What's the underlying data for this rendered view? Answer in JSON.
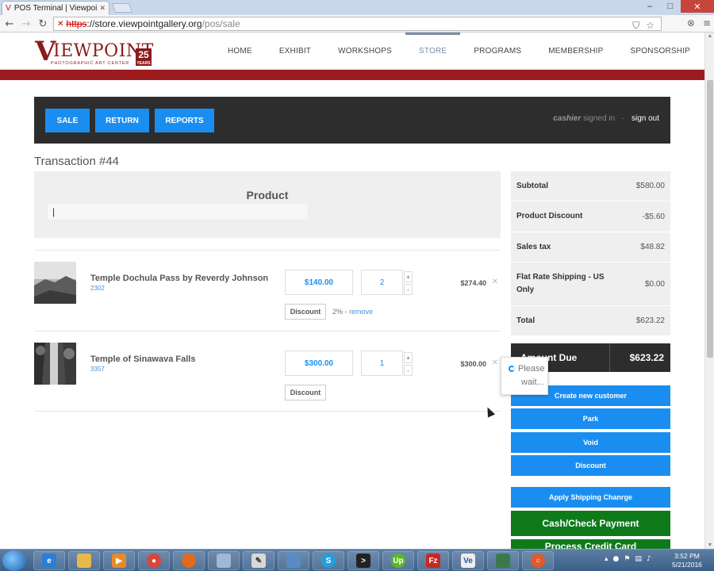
{
  "browser": {
    "tab_title": "POS Terminal | Viewpoint",
    "url_protocol": "https",
    "url_host": "://store.viewpointgallery.org",
    "url_path": "/pos/sale"
  },
  "site": {
    "logo_text": "VIEWPOINT",
    "logo_tagline": "PHOTOGRAPHIC ART CENTER",
    "logo_badge": "25",
    "logo_badge_sub": "YEARS",
    "nav": [
      "HOME",
      "EXHIBIT",
      "WORKSHOPS",
      "STORE",
      "PROGRAMS",
      "MEMBERSHIP",
      "SPONSORSHIP"
    ],
    "active_nav": "STORE",
    "brand_color": "#9b1b1f"
  },
  "pos": {
    "buttons": {
      "sale": "SALE",
      "return": "RETURN",
      "reports": "REPORTS"
    },
    "cashier": "cashier",
    "signed_in": "signed in",
    "sign_out": "sign out",
    "transaction_title": "Transaction #44",
    "product_label": "Product",
    "product_input_value": ""
  },
  "items": [
    {
      "name": "Temple Dochula Pass by Reverdy Johnson",
      "sku": "2302",
      "price": "$140.00",
      "qty": "2",
      "total": "$274.40",
      "discount_label": "Discount",
      "discount_note": "2% - ",
      "remove_label": "remove"
    },
    {
      "name": "Temple of Sinawava Falls",
      "sku": "3357",
      "price": "$300.00",
      "qty": "1",
      "total": "$300.00",
      "discount_label": "Discount"
    }
  ],
  "summary": {
    "subtotal_label": "Subtotal",
    "subtotal": "$580.00",
    "product_discount_label": "Product Discount",
    "product_discount": "-$5.60",
    "sales_tax_label": "Sales tax",
    "sales_tax": "$48.82",
    "shipping_label": "Flat Rate Shipping - US Only",
    "shipping": "$0.00",
    "total_label": "Total",
    "total": "$623.22",
    "amount_due_label": "Amount Due",
    "amount_due": "$623.22"
  },
  "actions": {
    "create_customer": "Create new customer",
    "park": "Park",
    "void": "Void",
    "discount": "Discount",
    "apply_shipping": "Apply Shipping Chanrge",
    "cash_check": "Cash/Check Payment",
    "next_partial": "Process Credit Card"
  },
  "wait_popup": {
    "line1": "Please",
    "line2": "wait..."
  },
  "taskbar": {
    "time": "3:52 PM",
    "date": "5/21/2016"
  },
  "colors": {
    "accent": "#1a8ef0",
    "dark": "#2d2d2d",
    "green": "#0f7a1a"
  }
}
